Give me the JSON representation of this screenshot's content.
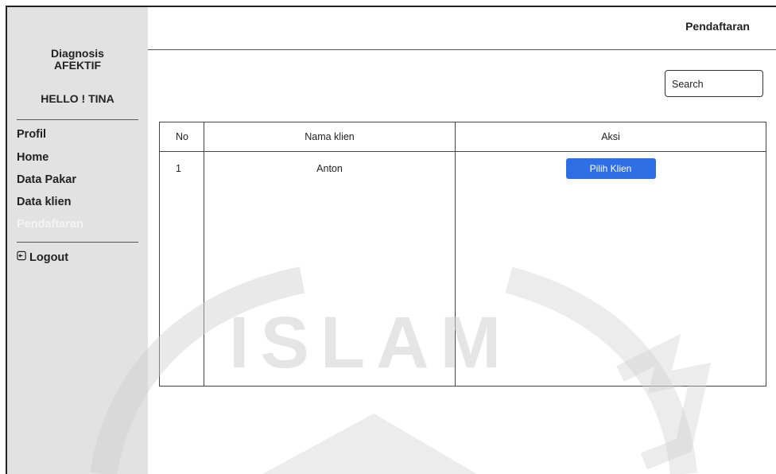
{
  "sidebar": {
    "brand_line1": "Diagnosis",
    "brand_line2": "AFEKTIF",
    "greeting": "HELLO ! TINA",
    "items": [
      {
        "label": "Profil"
      },
      {
        "label": "Home"
      },
      {
        "label": "Data Pakar"
      },
      {
        "label": "Data klien"
      },
      {
        "label": "Pendaftaran",
        "active": true
      }
    ],
    "logout_label": "Logout"
  },
  "header": {
    "title": "Pendaftaran"
  },
  "search": {
    "label": "Search"
  },
  "table": {
    "columns": [
      "No",
      "Nama klien",
      "Aksi"
    ],
    "rows": [
      {
        "no": "1",
        "name": "Anton",
        "action": "Pilih Klien"
      }
    ]
  },
  "watermark": {
    "text": "ISLAM"
  },
  "colors": {
    "sidebar_bg": "#e2e2e2",
    "button": "#2f6fe6",
    "active_item": "#f4f4f4"
  }
}
